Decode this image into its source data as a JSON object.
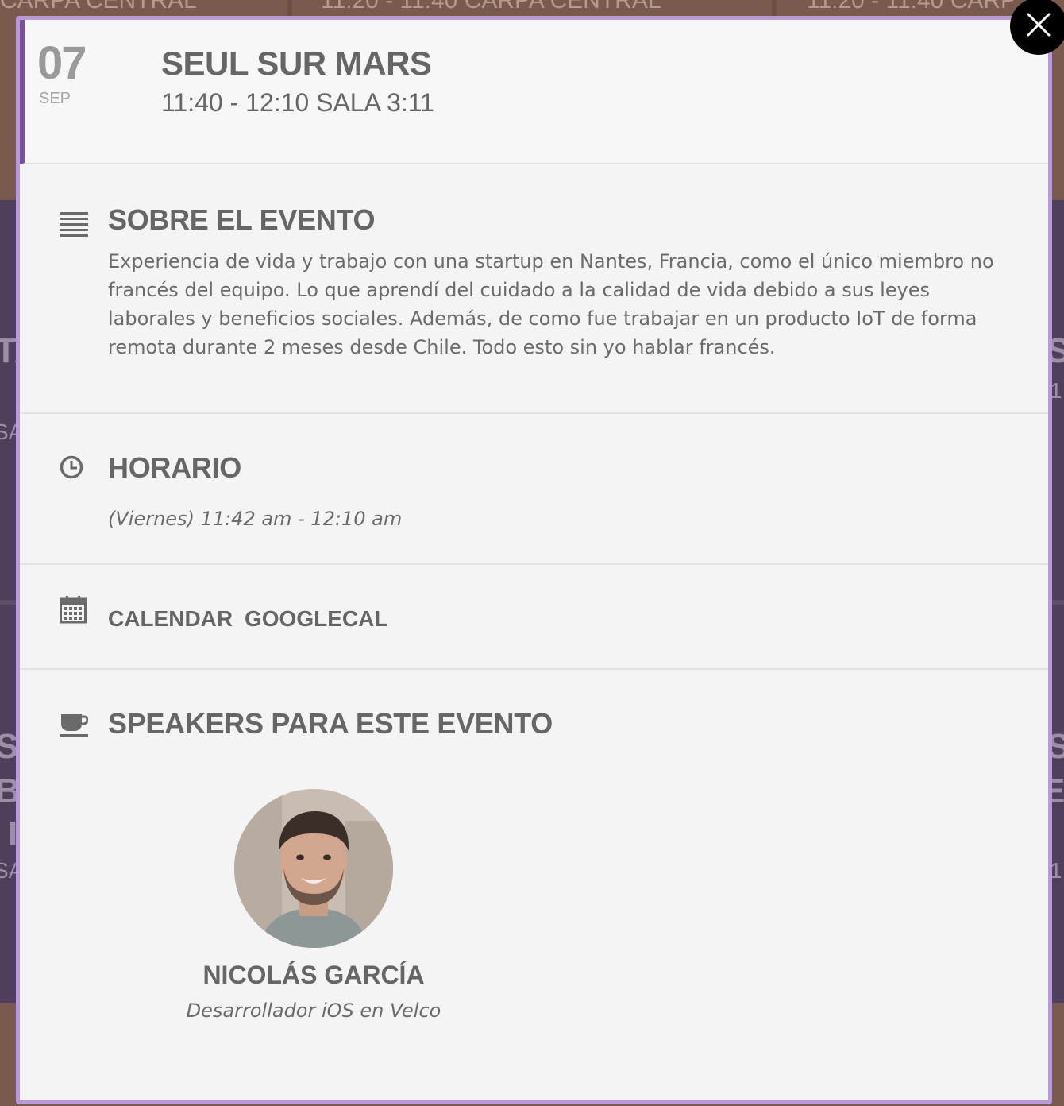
{
  "background": {
    "top_labels": [
      "CARPA CENTRAL",
      "11:20 - 11:40 CARPA CENTRAL",
      "11:20 - 11:40 CARP"
    ],
    "side_fragments": [
      "TA",
      "SA",
      "S",
      "1",
      "S",
      "B",
      "I",
      "SA",
      "S",
      "EI",
      "1"
    ]
  },
  "modal": {
    "date": {
      "day": "07",
      "month": "SEP"
    },
    "title": "SEUL SUR MARS",
    "subtitle": "11:40 - 12:10 SALA 3:11",
    "about": {
      "icon": "list-icon",
      "title": "SOBRE EL EVENTO",
      "text": "Experiencia de vida y trabajo con una startup en Nantes, Francia, como el único miembro no francés del equipo. Lo que aprendí del cuidado a la calidad de vida debido a sus leyes laborales y beneficios sociales. Además, de como fue trabajar en un producto IoT de forma remota durante 2 meses desde Chile. Todo esto sin yo hablar francés."
    },
    "schedule": {
      "icon": "clock-icon",
      "title": "HORARIO",
      "text": "(Viernes) 11:42 am - 12:10 am"
    },
    "calendar": {
      "icon": "calendar-icon",
      "links": [
        "CALENDAR",
        "GOOGLECAL"
      ]
    },
    "speakers": {
      "icon": "coffee-cup-icon",
      "title": "SPEAKERS PARA ESTE EVENTO",
      "items": [
        {
          "name": "NICOLÁS GARCÍA",
          "role": "Desarrollador iOS en Velco"
        }
      ]
    },
    "close_icon": "close-icon"
  }
}
